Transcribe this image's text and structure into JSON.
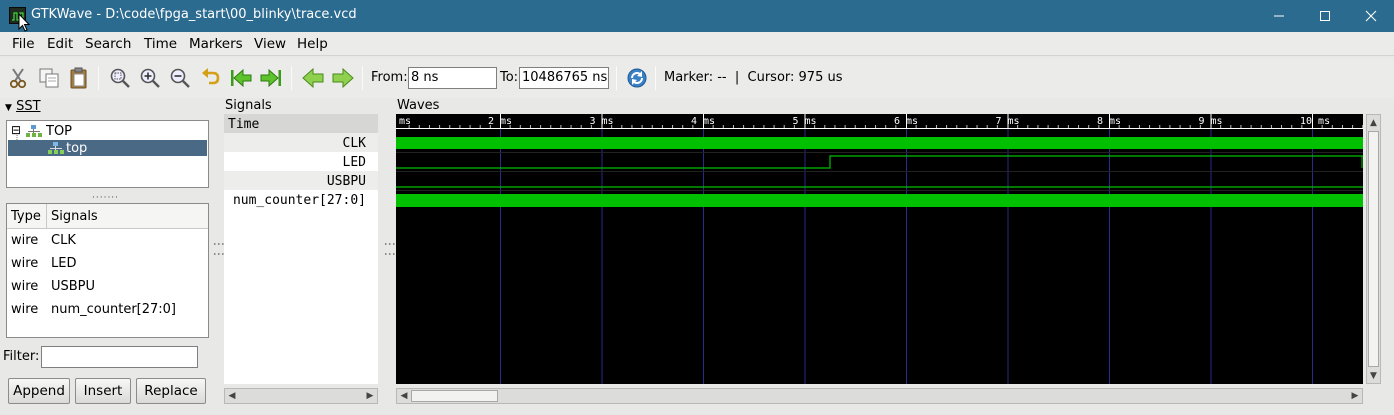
{
  "window": {
    "title": "GTKWave - D:\\code\\fpga_start\\00_blinky\\trace.vcd",
    "minimize": "—",
    "maximize": "☐",
    "close": "✕"
  },
  "menu": [
    "File",
    "Edit",
    "Search",
    "Time",
    "Markers",
    "View",
    "Help"
  ],
  "toolbar": {
    "from_label": "From:",
    "from_value": "8 ns",
    "to_label": "To:",
    "to_value": "10486765 ns",
    "marker_text": "Marker: --  |  Cursor: 975 us",
    "icons": [
      "cut-icon",
      "copy-icon",
      "paste-icon",
      "zoom-fit-icon",
      "zoom-in-icon",
      "zoom-out-icon",
      "undo-zoom-icon",
      "zoom-to-start-icon",
      "zoom-to-end-icon",
      "find-previous-edge-icon",
      "find-next-edge-icon",
      "reload-icon"
    ]
  },
  "sst": {
    "header": "SST",
    "tree": [
      {
        "label": "TOP",
        "expand": "⊟"
      },
      {
        "label": "top",
        "selected": true
      }
    ],
    "grip": "·······",
    "columns": {
      "type": "Type",
      "signals": "Signals"
    },
    "signals": [
      {
        "type": "wire",
        "name": "CLK"
      },
      {
        "type": "wire",
        "name": "LED"
      },
      {
        "type": "wire",
        "name": "USBPU"
      },
      {
        "type": "wire",
        "name": "num_counter[27:0]"
      }
    ],
    "filter_label": "Filter:",
    "filter_value": "",
    "buttons": {
      "append": "Append",
      "insert": "Insert",
      "replace": "Replace"
    }
  },
  "signals_pane": {
    "header": "Signals",
    "time_label": "Time",
    "rows": [
      "CLK",
      "LED",
      "USBPU",
      "num_counter[27:0]"
    ]
  },
  "waves_pane": {
    "header": "Waves",
    "time_labels": [
      "ms",
      "2 ms",
      "3 ms",
      "4 ms",
      "5 ms",
      "6 ms",
      "7 ms",
      "8 ms",
      "9 ms",
      "10 ms"
    ]
  },
  "colors": {
    "titlebar": "#2b6b8f",
    "selection": "#4a6984",
    "wave_green": "#00c000",
    "wave_background": "#000000",
    "grid_line": "#2a2a8a"
  }
}
